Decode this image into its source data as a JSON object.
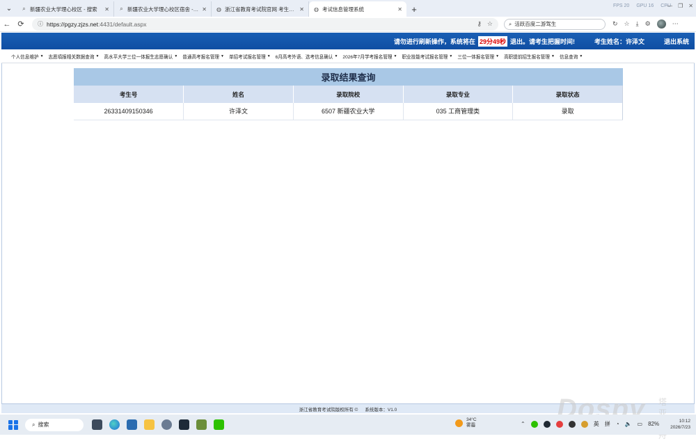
{
  "browser": {
    "tabs": [
      {
        "title": "新疆农业大学理心校区 - 搜索",
        "icon": "search-icon",
        "active": false
      },
      {
        "title": "新疆农业大学理心校区宿舍 - 搜索",
        "icon": "search-icon",
        "active": false
      },
      {
        "title": "浙江省教育考试院官网 考生办事",
        "icon": "globe-icon",
        "active": false
      },
      {
        "title": "考试信息管理系统",
        "icon": "globe-icon",
        "active": true
      }
    ],
    "sys_stats": [
      "FPS 20",
      "GPU 16",
      "CPU"
    ],
    "url": "https://pgzy.zjzs.net",
    "url_tail": ":4431/default.aspx",
    "search_text": "活跃百度二游驾生"
  },
  "site": {
    "warning_prefix": "请勿进行刷新操作，系统将在",
    "countdown": "29分49秒",
    "warning_suffix": "退出。请考生把握时间!",
    "candidate_label": "考生姓名：许泽文",
    "logout_label": "退出系统"
  },
  "menu": [
    "个人信息维护",
    "志愿填报相关数据查询",
    "高水平大学三位一体报生志愿确认",
    "普通高考报名管理",
    "单招考试报名管理",
    "6月高考外语、选考信息确认",
    "2026年7月学考报名管理",
    "职业技能考试报名管理",
    "三位一体报名管理",
    "高职提前招生报名管理",
    "信息查询"
  ],
  "results": {
    "title": "录取结果查询",
    "headers": [
      "考生号",
      "姓名",
      "录取院校",
      "录取专业",
      "录取状态"
    ],
    "rows": [
      [
        "26331409150346",
        "许泽文",
        "6507 新疆农业大学",
        "035 工商管理类",
        "录取"
      ]
    ]
  },
  "footer": {
    "copyright": "浙江省教育考试院版权所有 ©",
    "version": "系统版本：V1.0"
  },
  "taskbar": {
    "search_label": "搜索",
    "temperature": "34°C",
    "weather_text": "雾霾",
    "ime_lang": "英",
    "ime_mode": "拼",
    "battery": "82%",
    "time": "10:12",
    "date": "2026/7/23"
  },
  "watermark": {
    "main": "Dospy",
    "sub": "塔亚方舟"
  }
}
